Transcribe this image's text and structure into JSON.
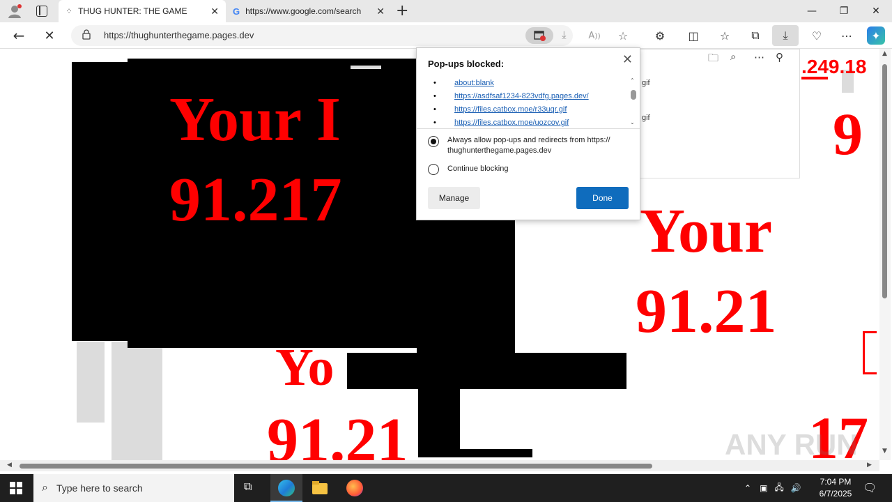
{
  "browser": {
    "tabs": [
      {
        "label": "THUG HUNTER: THE GAME",
        "icon": "loading-spinner-icon",
        "active": true
      },
      {
        "label": "https://www.google.com/search",
        "icon": "google-g-icon",
        "active": false
      }
    ],
    "new_tab": "+",
    "window_controls": {
      "minimize": "—",
      "restore": "❐",
      "close": "✕"
    },
    "address": "https://thughunterthegame.pages.dev"
  },
  "page": {
    "texts": {
      "your_1": "Your I",
      "ip_1": "91.217",
      "your_2": "Your",
      "ip_2": "91.21",
      "your_3": "Yo",
      "ip_3": "91.21",
      "corner_ip": ".249.18",
      "nine": "9",
      "seventeen": "17"
    },
    "colors": {
      "text_red": "#ff0000",
      "block": "#000000"
    }
  },
  "popup": {
    "title": "Pop-ups blocked:",
    "items": [
      "about:blank",
      "https://asdfsaf1234-823vdfg.pages.dev/",
      "https://files.catbox.moe/r33uqr.gif",
      "https://files.catbox.moe/uozcov.gif"
    ],
    "option_allow": "Always allow pop-ups and redirects from https://thughunterthegame.pages.dev",
    "option_allow_line1": "Always allow pop-ups and redirects from https://",
    "option_allow_line2": "thughunterthegame.pages.dev",
    "option_block": "Continue blocking",
    "manage_label": "Manage",
    "done_label": "Done",
    "selected": "allow"
  },
  "downloads_panel": {
    "items": [
      "gif",
      "gif"
    ]
  },
  "taskbar": {
    "search_placeholder": "Type here to search",
    "time": "7:04 PM",
    "date": "6/7/2025"
  },
  "watermark": "ANY RUN"
}
